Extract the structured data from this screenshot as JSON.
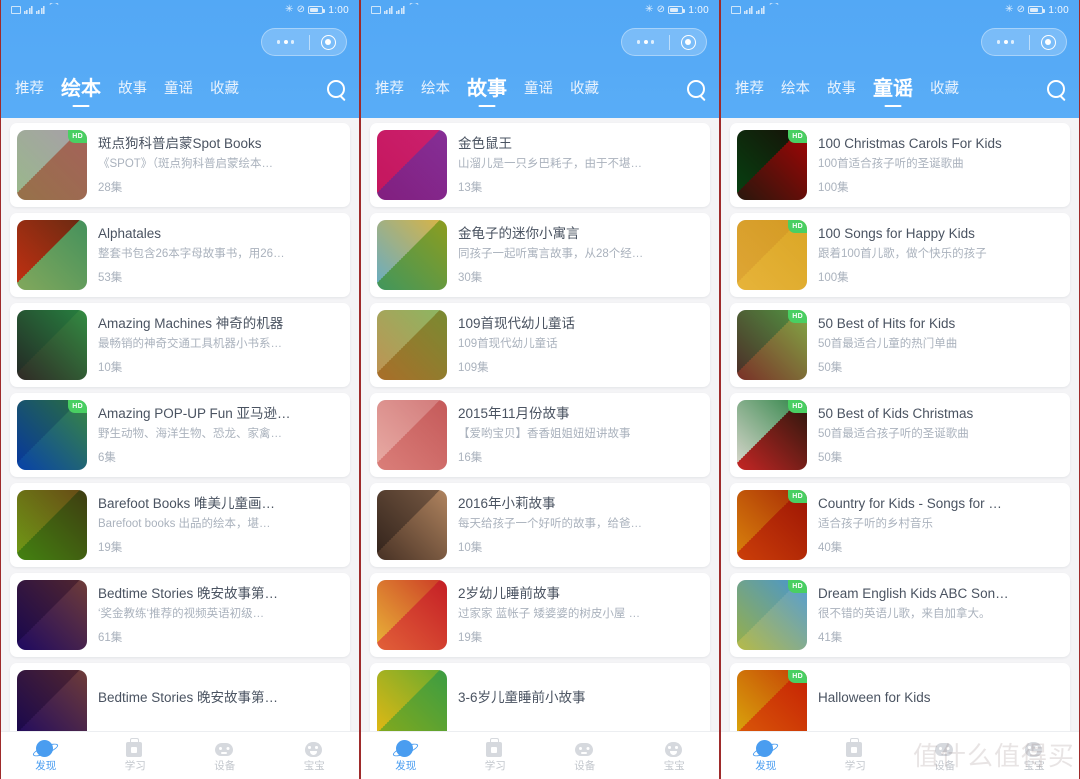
{
  "status_bar": {
    "time": "1:00",
    "battery": "50"
  },
  "capsule": {
    "menu": "•••",
    "target": "target-icon"
  },
  "bottom_nav": [
    {
      "label": "发现",
      "icon": "planet-icon",
      "active": true
    },
    {
      "label": "学习",
      "icon": "school-bag-icon",
      "active": false
    },
    {
      "label": "设备",
      "icon": "robot-device-icon",
      "active": false
    },
    {
      "label": "宝宝",
      "icon": "baby-face-icon",
      "active": false
    }
  ],
  "watermark": "值什么值得买",
  "badge_hd": "HD",
  "panels": [
    {
      "tabs": [
        "推荐",
        "绘本",
        "故事",
        "童谣",
        "收藏"
      ],
      "active_tab": "绘本",
      "active_index": 1,
      "items": [
        {
          "title": "斑点狗科普启蒙Spot Books",
          "subtitle": "《SPOT》（斑点狗科普启蒙绘本…",
          "count": "28集",
          "hd": true,
          "c1": "#e8e0c8",
          "c2": "#e48a6a",
          "c3": "#a8d2b0",
          "c4": "#b8b4d8"
        },
        {
          "title": "Alphatales",
          "subtitle": "整套书包含26本字母故事书，用26…",
          "count": "53集",
          "hd": false,
          "c1": "#d83a2a",
          "c2": "#8fc9dd",
          "c3": "#e8d56a",
          "c4": "#7ab86a"
        },
        {
          "title": "Amazing Machines 神奇的机器",
          "subtitle": "最畅销的神奇交通工具机器小书系…",
          "count": "10集",
          "hd": false,
          "c1": "#2ba9dc",
          "c2": "#38b6e4",
          "c3": "#d83a2a",
          "c4": "#e8c44a"
        },
        {
          "title": "Amazing POP-UP Fun 亚马逊…",
          "subtitle": "野生动物、海洋生物、恐龙、家禽…",
          "count": "6集",
          "hd": true,
          "c1": "#2f7fd4",
          "c2": "#3f9ae0",
          "c3": "#1f6cc0",
          "c4": "#e8e04a"
        },
        {
          "title": "Barefoot Books 唯美儿童画…",
          "subtitle": "Barefoot books 出品的绘本，堪…",
          "count": "19集",
          "hd": false,
          "c1": "#7abf4a",
          "c2": "#4aa03a",
          "c3": "#e8d04a",
          "c4": "#d8604a"
        },
        {
          "title": "Bedtime Stories 晚安故事第…",
          "subtitle": "‘奖金教练‘推荐的视频英语初级…",
          "count": "61集",
          "hd": false,
          "c1": "#5a2f9e",
          "c2": "#7a4ac0",
          "c3": "#3f1f80",
          "c4": "#e8d04a"
        },
        {
          "title": "Bedtime Stories 晚安故事第…",
          "subtitle": "",
          "count": "",
          "hd": false,
          "c1": "#5a2f9e",
          "c2": "#7a4ac0",
          "c3": "#3f1f80",
          "c4": "#e8d04a"
        }
      ]
    },
    {
      "tabs": [
        "推荐",
        "绘本",
        "故事",
        "童谣",
        "收藏"
      ],
      "active_tab": "故事",
      "active_index": 2,
      "items": [
        {
          "title": "金色鼠王",
          "subtitle": "山溜儿是一只乡巴耗子，由于不堪…",
          "count": "13集",
          "hd": false,
          "c1": "#d8348c",
          "c2": "#8e4ac0",
          "c3": "#e86aa8",
          "c4": "#f0a0c8"
        },
        {
          "title": "金龟子的迷你小寓言",
          "subtitle": "同孩子一起听寓言故事，从28个经…",
          "count": "30集",
          "hd": false,
          "c1": "#f2efe2",
          "c2": "#9bd06a",
          "c3": "#6ab8e0",
          "c4": "#e8c04a"
        },
        {
          "title": "109首现代幼儿童话",
          "subtitle": "109首现代幼儿童话",
          "count": "109集",
          "hd": false,
          "c1": "#f6f4ee",
          "c2": "#d8b878",
          "c3": "#c89858",
          "c4": "#8fc06a"
        },
        {
          "title": "2015年11月份故事",
          "subtitle": "【爱哟宝贝】香香姐姐妞妞讲故事",
          "count": "16集",
          "hd": false,
          "c1": "#f7e4e4",
          "c2": "#e8a8a8",
          "c3": "#f0c0b8",
          "c4": "#d88888"
        },
        {
          "title": "2016年小莉故事",
          "subtitle": "每天给孩子一个好听的故事，给爸…",
          "count": "10集",
          "hd": false,
          "c1": "#8a7468",
          "c2": "#c8a890",
          "c3": "#5a4a40",
          "c4": "#e0c8a8"
        },
        {
          "title": "2岁幼儿睡前故事",
          "subtitle": "过家家 蓝帐子 矮婆婆的树皮小屋 …",
          "count": "19集",
          "hd": false,
          "c1": "#f0c85a",
          "c2": "#e86a5a",
          "c3": "#f8e8a0",
          "c4": "#d84a6a"
        },
        {
          "title": "3-6岁儿童睡前小故事",
          "subtitle": "",
          "count": "",
          "hd": false,
          "c1": "#f5e24a",
          "c2": "#8fd06a",
          "c3": "#f0d040",
          "c4": "#6ac0a0"
        }
      ]
    },
    {
      "tabs": [
        "推荐",
        "绘本",
        "故事",
        "童谣",
        "收藏"
      ],
      "active_tab": "童谣",
      "active_index": 3,
      "items": [
        {
          "title": "100 Christmas Carols For Kids",
          "subtitle": "100首适合孩子听的圣诞歌曲",
          "count": "100集",
          "hd": true,
          "c1": "#1f7a3a",
          "c2": "#d82a2a",
          "c3": "#2f8a4a",
          "c4": "#c01f1f"
        },
        {
          "title": "100 Songs for Happy Kids",
          "subtitle": "跟着100首儿歌，做个快乐的孩子",
          "count": "100集",
          "hd": true,
          "c1": "#e8c8b8",
          "c2": "#f0d8c8",
          "c3": "#f5d44a",
          "c4": "#e8c430"
        },
        {
          "title": "50 Best of Hits for Kids",
          "subtitle": "50首最适合儿童的热门单曲",
          "count": "50集",
          "hd": true,
          "c1": "#5ab8e8",
          "c2": "#8fd0f0",
          "c3": "#d83a2a",
          "c4": "#e8d04a"
        },
        {
          "title": "50 Best of Kids Christmas",
          "subtitle": "50首最适合孩子听的圣诞歌曲",
          "count": "50集",
          "hd": true,
          "c1": "#f2f2f0",
          "c2": "#d82a2a",
          "c3": "#e8e4dc",
          "c4": "#2f8a4a"
        },
        {
          "title": "Country for Kids - Songs for …",
          "subtitle": "适合孩子听的乡村音乐",
          "count": "40集",
          "hd": true,
          "c1": "#e8a82a",
          "c2": "#d8501f",
          "c3": "#f0c84a",
          "c4": "#b84020"
        },
        {
          "title": "Dream English Kids ABC Son…",
          "subtitle": "很不错的英语儿歌，来自加拿大。",
          "count": "41集",
          "hd": true,
          "c1": "#a8d8f0",
          "c2": "#c8e4f5",
          "c3": "#e8d04a",
          "c4": "#6ab0e0"
        },
        {
          "title": "Halloween for Kids",
          "subtitle": "",
          "count": "",
          "hd": true,
          "c1": "#e8c82a",
          "c2": "#e86a1f",
          "c3": "#f0d84a",
          "c4": "#d8501f"
        }
      ]
    }
  ]
}
